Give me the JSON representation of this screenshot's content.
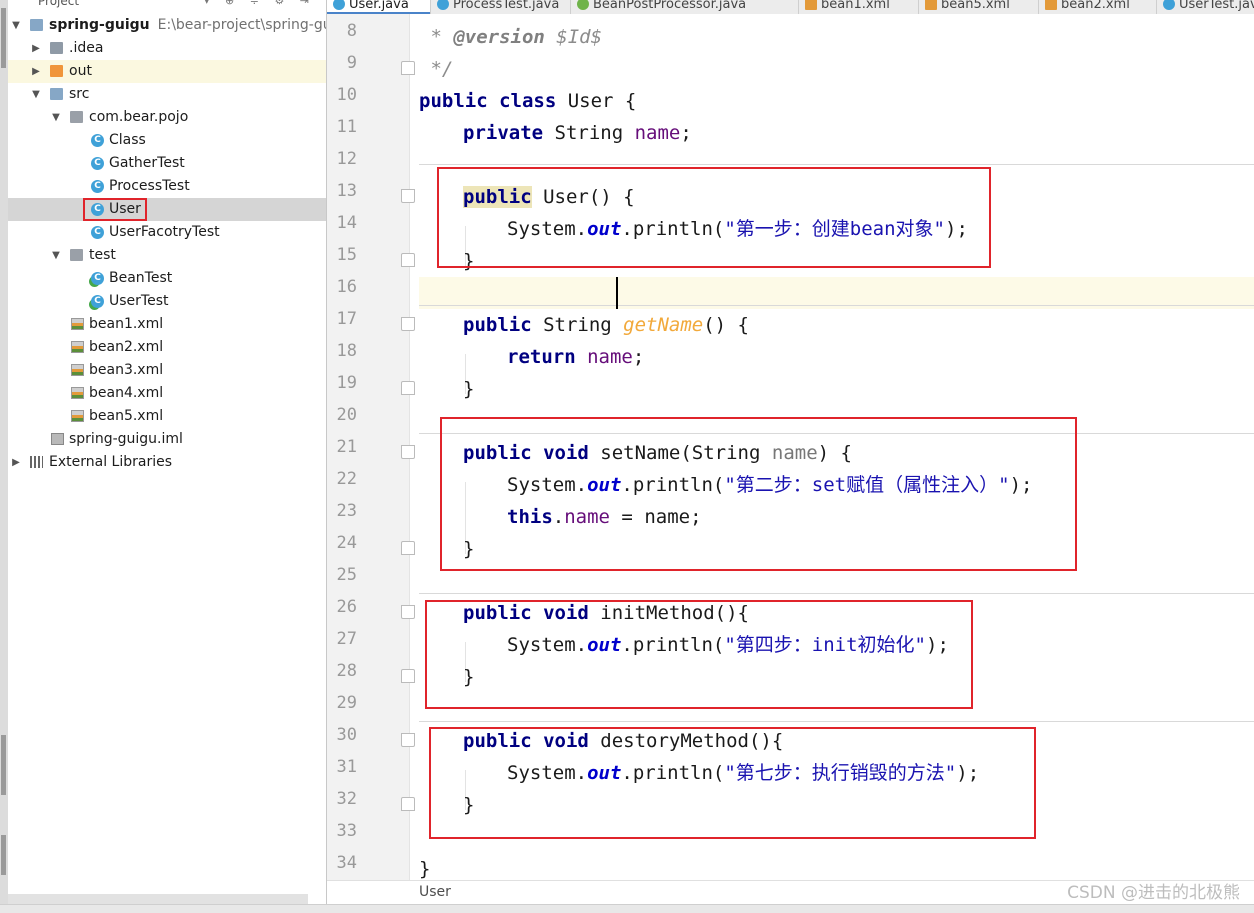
{
  "project_panel": {
    "title": "Project",
    "tree": [
      {
        "label": "spring-guigu",
        "path": "E:\\bear-project\\spring-guigu",
        "bold": true
      },
      {
        "label": ".idea"
      },
      {
        "label": "out"
      },
      {
        "label": "src"
      },
      {
        "label": "com.bear.pojo"
      },
      {
        "label": "Class"
      },
      {
        "label": "GatherTest"
      },
      {
        "label": "ProcessTest"
      },
      {
        "label": "User"
      },
      {
        "label": "UserFacotryTest"
      },
      {
        "label": "test"
      },
      {
        "label": "BeanTest"
      },
      {
        "label": "UserTest"
      },
      {
        "label": "bean1.xml"
      },
      {
        "label": "bean2.xml"
      },
      {
        "label": "bean3.xml"
      },
      {
        "label": "bean4.xml"
      },
      {
        "label": "bean5.xml"
      },
      {
        "label": "spring-guigu.iml"
      },
      {
        "label": "External Libraries"
      }
    ]
  },
  "tabs": [
    "User.java",
    "ProcessTest.java",
    "BeanPostProcessor.java",
    "bean1.xml",
    "bean5.xml",
    "bean2.xml",
    "UserTest.java"
  ],
  "editor": {
    "line_numbers": [
      "8",
      "9",
      "10",
      "11",
      "12",
      "13",
      "14",
      "15",
      "16",
      "17",
      "18",
      "19",
      "20",
      "21",
      "22",
      "23",
      "24",
      "25",
      "26",
      "27",
      "28",
      "29",
      "30",
      "31",
      "32",
      "33",
      "34"
    ],
    "code": {
      "l8_star": " * ",
      "l8_tag": "@version",
      "l8_val": " $Id$",
      "l9": " */",
      "l10_kw": "public class",
      "l10_rest": " User {",
      "l11_kw": "private",
      "l11_type": " String ",
      "l11_field": "name",
      "l11_end": ";",
      "l13_kw": "public",
      "l13_rest": " User() {",
      "l14_a": "System.",
      "l14_out": "out",
      "l14_b": ".println(",
      "l14_str": "\"第一步：创建bean对象\"",
      "l14_c": ");",
      "l15": "}",
      "l17_kw": "public",
      "l17_type": " String ",
      "l17_m": "getName",
      "l17_rest": "() {",
      "l18_kw": "return",
      "l18_sp": " ",
      "l18_f": "name",
      "l18_end": ";",
      "l19": "}",
      "l21_kw": "public void",
      "l21_a": " setName(String ",
      "l21_p": "name",
      "l21_b": ") {",
      "l22_a": "System.",
      "l22_out": "out",
      "l22_b": ".println(",
      "l22_str": "\"第二步：set赋值（属性注入）\"",
      "l22_c": ");",
      "l23_kw": "this",
      "l23_dot": ".",
      "l23_f": "name",
      "l23_rest": " = ",
      "l23_p": "name",
      "l23_end": ";",
      "l24": "}",
      "l26_kw": "public void",
      "l26_rest": " initMethod(){",
      "l27_a": "System.",
      "l27_out": "out",
      "l27_b": ".println(",
      "l27_str": "\"第四步：init初始化\"",
      "l27_c": ");",
      "l28": "}",
      "l30_kw": "public void",
      "l30_rest": " destoryMethod(){",
      "l31_a": "System.",
      "l31_out": "out",
      "l31_b": ".println(",
      "l31_str": "\"第七步：执行销毁的方法\"",
      "l31_c": ");",
      "l32": "}",
      "l34": "}"
    }
  },
  "breadcrumb": "User",
  "watermark": "CSDN @进击的北极熊"
}
